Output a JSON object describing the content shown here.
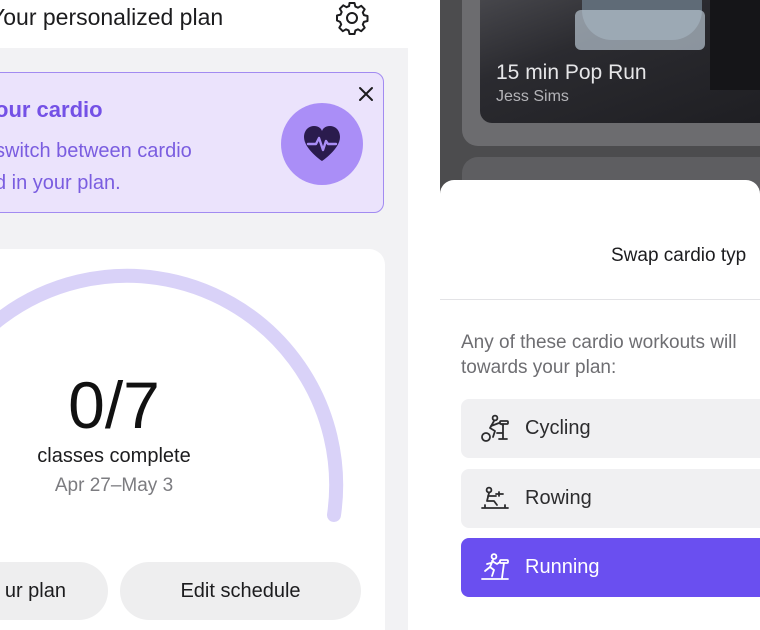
{
  "plan_screen": {
    "title": "Your personalized plan",
    "banner": {
      "title": "our cardio",
      "body": "switch between cardio\nd in your plan."
    },
    "progress": {
      "count": "0/7",
      "label": "classes complete",
      "dates": "Apr 27–May 3",
      "completed": 0,
      "total": 7
    },
    "buttons": {
      "plan": "ur plan",
      "edit": "Edit schedule"
    }
  },
  "swap_screen": {
    "class_card": {
      "title": "15 min Pop Run",
      "instructor": "Jess Sims"
    },
    "sheet": {
      "title": "Swap cardio typ",
      "description": "Any of these cardio workouts will\ntowards your plan:",
      "options": [
        {
          "label": "Cycling",
          "icon": "cycling-icon",
          "selected": false
        },
        {
          "label": "Rowing",
          "icon": "rowing-icon",
          "selected": false
        },
        {
          "label": "Running",
          "icon": "running-icon",
          "selected": true
        }
      ]
    }
  },
  "colors": {
    "accent": "#6a4ff0",
    "banner_bg": "#ebe3fc",
    "banner_text": "#7451e6",
    "progress_track": "#d9d2f8"
  }
}
